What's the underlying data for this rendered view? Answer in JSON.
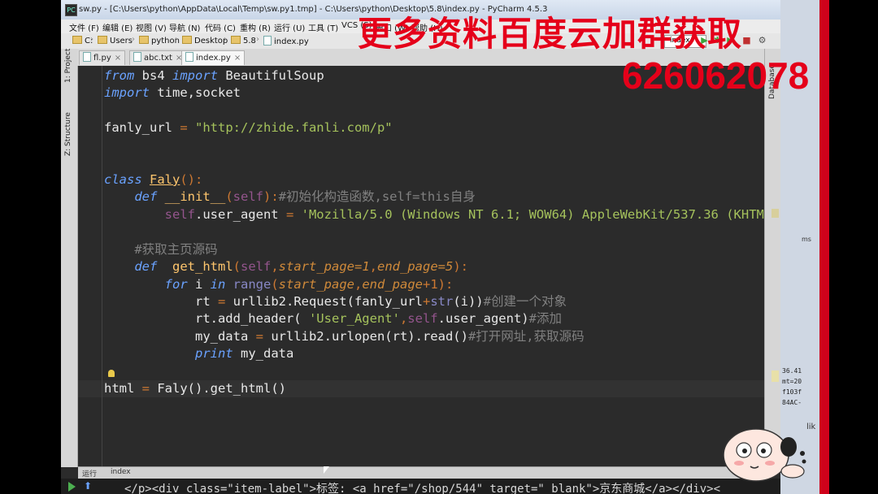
{
  "window": {
    "title": "sw.py - [C:\\Users\\python\\AppData\\Local\\Temp\\sw.py1.tmp] - C:\\Users\\python\\Desktop\\5.8\\index.py - PyCharm 4.5.3",
    "icon": "pycharm-icon"
  },
  "menu": [
    "文件 (F)",
    "编辑 (E)",
    "视图 (V)",
    "导航 (N)",
    "代码 (C)",
    "重构 (R)",
    "运行 (U)",
    "工具 (T)",
    "VCS (S)",
    "窗口 (W)",
    "帮助 (H)"
  ],
  "breadcrumb": [
    "C:",
    "Users",
    "python",
    "Desktop",
    "5.8",
    "index.py"
  ],
  "run_config": "index",
  "tabs": [
    {
      "label": "fl.py",
      "active": false
    },
    {
      "label": "abc.txt",
      "active": false
    },
    {
      "label": "index.py",
      "active": true
    }
  ],
  "side_panels": {
    "left": [
      "1: Project",
      "Z: Structure"
    ],
    "right": [
      "Database"
    ]
  },
  "code": {
    "l1": {
      "kw1": "from",
      "mod": " bs4 ",
      "kw2": "import",
      "rest": " BeautifulSoup"
    },
    "l2": {
      "kw": "import",
      "rest": " time,socket"
    },
    "l4": {
      "var": "fanly_url ",
      "eq": "=",
      "str": " \"http://zhide.fanli.com/p\""
    },
    "l7": {
      "kw": "class",
      "name": "Faly",
      "rest": "():"
    },
    "l8": {
      "kw": "def",
      "name": " __init__",
      "p1": "(",
      "self": "self",
      "p2": "):",
      "comment": "#初始化构造函数,self=this自身"
    },
    "l9": {
      "self": "self",
      "rest": ".user_agent ",
      "eq": "=",
      "str": " 'Mozilla/5.0 (Windows NT 6.1; WOW64) AppleWebKit/537.36 (KHTM"
    },
    "l11": {
      "comment": "#获取主页源码"
    },
    "l12": {
      "kw": "def",
      "name": "  get_html",
      "p1": "(",
      "self": "self",
      "c1": ",",
      "param1": "start_page",
      "d1": "=1",
      "c2": ",",
      "param2": "end_page",
      "d2": "=5",
      "p2": "):"
    },
    "l13": {
      "kw1": "for",
      "var": " i ",
      "kw2": "in",
      "fn": " range",
      "p1": "(",
      "param1": "start_page",
      "c": ",",
      "param2": "end_page",
      "rest": "+1):"
    },
    "l14": {
      "var": "rt ",
      "eq": "=",
      "mid": " urllib2.Request(fanly_url",
      "plus": "+",
      "bi": "str",
      "rest": "(i))",
      "comment": "#创建一个对象"
    },
    "l15": {
      "call": "rt.add_header( ",
      "str": "'User_Agent'",
      "c": ",",
      "self": "self",
      "rest": ".user_agent)",
      "comment": "#添加"
    },
    "l16": {
      "var": "my_data ",
      "eq": "=",
      "rest": " urllib2.urlopen(rt).read()",
      "comment": "#打开网址,获取源码"
    },
    "l17": {
      "kw": "print",
      "rest": " my_data"
    },
    "l19": {
      "var": "html ",
      "eq": "=",
      "rest": " Faly().get_html()"
    }
  },
  "status": {
    "tool_window": "运行",
    "config": "index"
  },
  "run_output": "</p><div class=\"item-label\">标签: <a href=\"/shop/544\" target=\"_blank\">京东商城</a></div><",
  "background_text": {
    "right_panel": "36.41\nmt=20\nf103f\n84AC-",
    "ms": "ms",
    "lik": "lik"
  },
  "watermark": {
    "line1": "更多资料百度云加群获取",
    "line2": "626062078"
  },
  "colors": {
    "editor_bg": "#2b2b2b",
    "keyword": "#6aa2ff",
    "string": "#a5c25c",
    "comment": "#808080",
    "self": "#94558d",
    "param": "#d08a3a",
    "watermark": "#e5001a"
  }
}
